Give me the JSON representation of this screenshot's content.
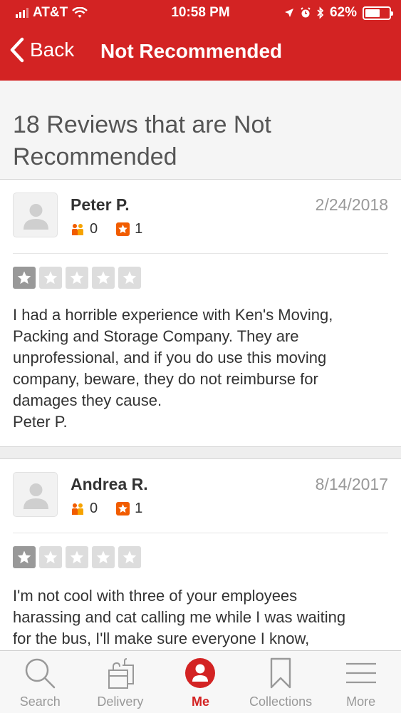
{
  "status_bar": {
    "carrier": "AT&T",
    "time": "10:58 PM",
    "battery": "62%",
    "battery_level": 0.62
  },
  "nav": {
    "back_label": "Back",
    "title": "Not Recommended"
  },
  "section": {
    "heading": "18 Reviews that are Not Recommended"
  },
  "reviews": [
    {
      "name": "Peter P.",
      "date": "2/24/2018",
      "friends": "0",
      "reviews": "1",
      "rating": 1,
      "text_lines": [
        "I had a horrible experience with Ken's Moving,",
        "Packing and Storage Company.  They are",
        "unprofessional, and if you do use this moving",
        "company, beware, they do not reimburse for",
        "damages they cause.",
        "Peter P."
      ]
    },
    {
      "name": "Andrea R.",
      "date": "8/14/2017",
      "friends": "0",
      "reviews": "1",
      "rating": 1,
      "text_lines": [
        "I'm not cool with three of your employees",
        "harassing and cat calling me while I was waiting",
        "for the bus, I'll make sure everyone I know,"
      ]
    }
  ],
  "tabbar": {
    "tabs": [
      {
        "label": "Search",
        "icon": "magnifier-icon"
      },
      {
        "label": "Delivery",
        "icon": "delivery-bag-icon"
      },
      {
        "label": "Me",
        "icon": "person-icon",
        "active": true
      },
      {
        "label": "Collections",
        "icon": "bookmark-icon"
      },
      {
        "label": "More",
        "icon": "hamburger-icon"
      }
    ]
  },
  "colors": {
    "brand_red": "#d32323",
    "star_on": "#999999",
    "star_off": "#dddddd",
    "stat_orange": "#f15c00"
  }
}
